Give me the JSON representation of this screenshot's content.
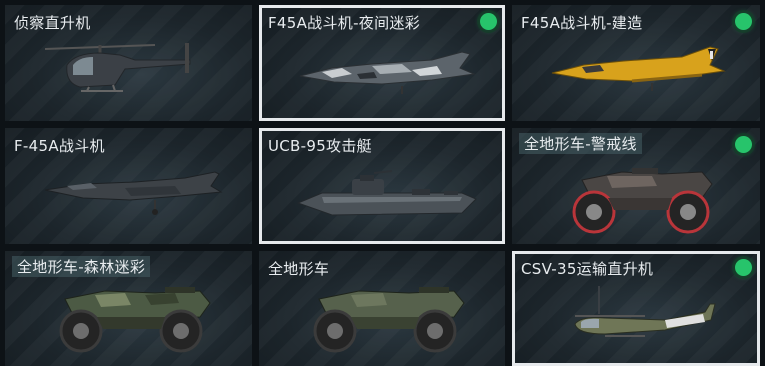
{
  "vehicles": [
    {
      "label": "侦察直升机",
      "icon": "scout-helicopter-icon",
      "selected": false,
      "equipped": false
    },
    {
      "label": "F45A战斗机-夜间迷彩",
      "icon": "jet-fighter-night-camo-icon",
      "selected": true,
      "equipped": true
    },
    {
      "label": "F45A战斗机-建造",
      "icon": "jet-fighter-construction-icon",
      "selected": false,
      "equipped": true
    },
    {
      "label": "F-45A战斗机",
      "icon": "jet-fighter-icon",
      "selected": false,
      "equipped": false
    },
    {
      "label": "UCB-95攻击艇",
      "icon": "attack-boat-icon",
      "selected": true,
      "equipped": false
    },
    {
      "label": "全地形车-警戒线",
      "icon": "atv-caution-icon",
      "selected": false,
      "equipped": true
    },
    {
      "label": "全地形车-森林迷彩",
      "icon": "atv-forest-camo-icon",
      "selected": false,
      "equipped": false
    },
    {
      "label": "全地形车",
      "icon": "atv-icon",
      "selected": false,
      "equipped": false
    },
    {
      "label": "CSV-35运输直升机",
      "icon": "transport-helicopter-icon",
      "selected": true,
      "equipped": true
    }
  ],
  "colors": {
    "equipped_dot": "#27c46b",
    "selected_border": "#e6e9ec",
    "construction_yellow": "#d8a21c"
  }
}
